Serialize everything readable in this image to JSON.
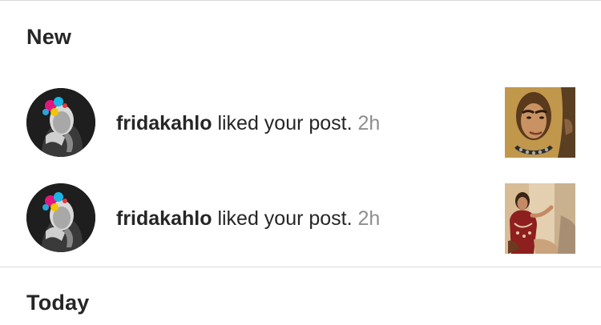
{
  "sections": {
    "new_title": "New",
    "today_title": "Today"
  },
  "notifications": [
    {
      "username": "fridakahlo",
      "action": "liked your post.",
      "time": "2h",
      "avatar_icon": "profile-photo",
      "thumbnail_icon": "post-photo"
    },
    {
      "username": "fridakahlo",
      "action": "liked your post.",
      "time": "2h",
      "avatar_icon": "profile-photo",
      "thumbnail_icon": "post-photo"
    }
  ],
  "colors": {
    "text": "#262626",
    "secondary_text": "#8e8e8e",
    "divider": "#dbdbdb",
    "background": "#ffffff"
  }
}
